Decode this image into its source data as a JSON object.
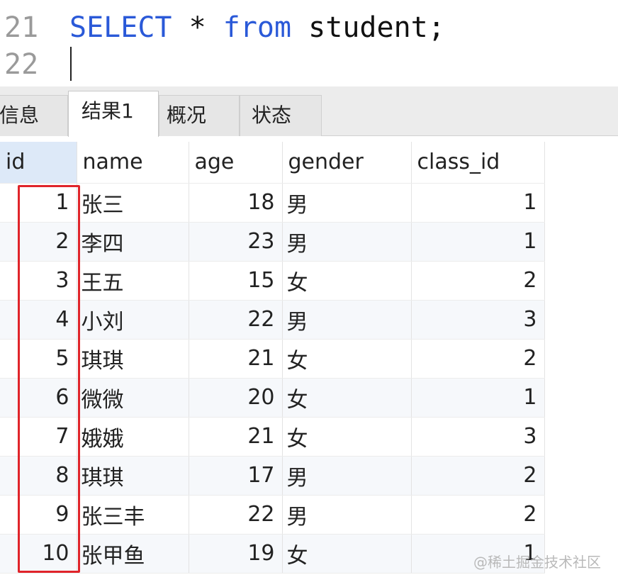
{
  "editor": {
    "lines": [
      {
        "number": "21",
        "tokens": [
          {
            "text": "SELECT",
            "kind": "keyword"
          },
          {
            "text": " * ",
            "kind": "plain"
          },
          {
            "text": "from",
            "kind": "keyword"
          },
          {
            "text": " student;",
            "kind": "plain"
          }
        ]
      },
      {
        "number": "22",
        "tokens": []
      }
    ],
    "keyword_color": "#2a59d8"
  },
  "tabs": [
    {
      "label": "信息",
      "active": false
    },
    {
      "label": "结果1",
      "active": true
    },
    {
      "label": "概况",
      "active": false
    },
    {
      "label": "状态",
      "active": false
    }
  ],
  "grid": {
    "columns": [
      "id",
      "name",
      "age",
      "gender",
      "class_id"
    ],
    "rows": [
      [
        "1",
        "张三",
        "18",
        "男",
        "1"
      ],
      [
        "2",
        "李四",
        "23",
        "男",
        "1"
      ],
      [
        "3",
        "王五",
        "15",
        "女",
        "2"
      ],
      [
        "4",
        "小刘",
        "22",
        "男",
        "3"
      ],
      [
        "5",
        "琪琪",
        "21",
        "女",
        "2"
      ],
      [
        "6",
        "微微",
        "20",
        "女",
        "1"
      ],
      [
        "7",
        "娥娥",
        "21",
        "女",
        "3"
      ],
      [
        "8",
        "琪琪",
        "17",
        "男",
        "2"
      ],
      [
        "9",
        "张三丰",
        "22",
        "男",
        "2"
      ],
      [
        "10",
        "张甲鱼",
        "19",
        "女",
        "1"
      ]
    ],
    "highlight_color": "#e0242a"
  },
  "watermark": "@稀土掘金技术社区"
}
